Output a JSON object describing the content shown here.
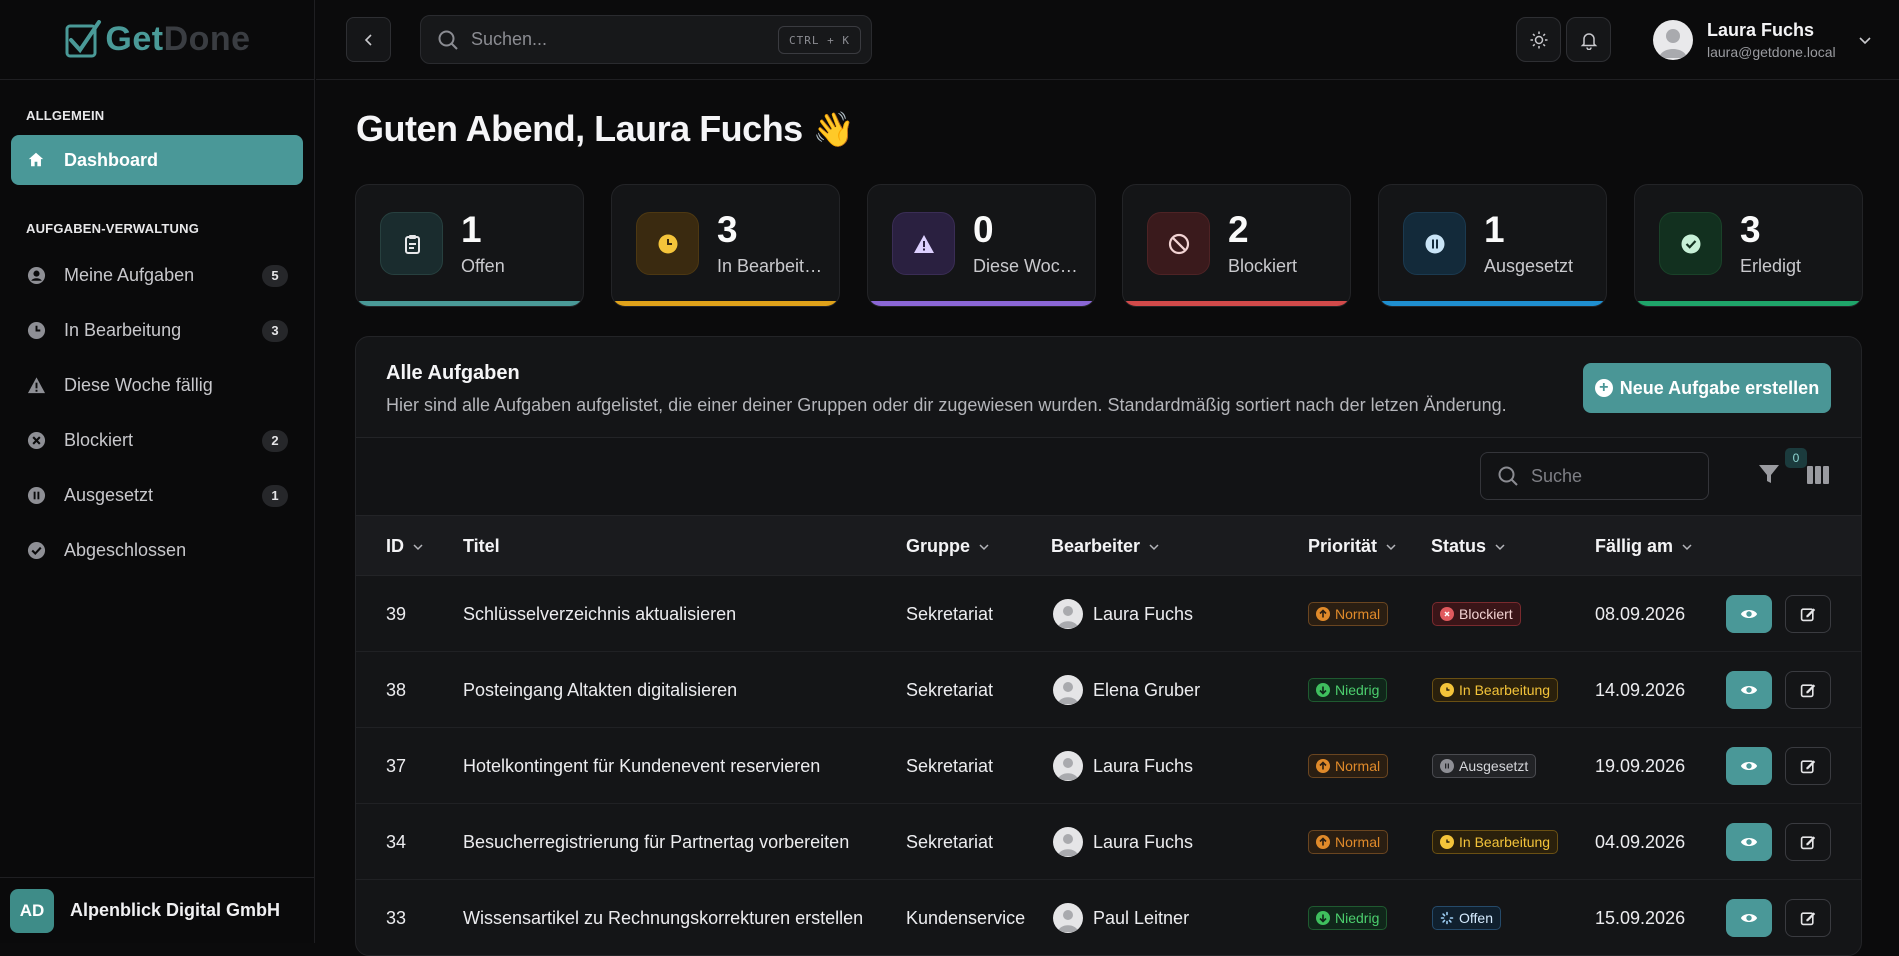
{
  "app": {
    "logo_get": "Get",
    "logo_done": "Done"
  },
  "sidebar": {
    "section_general": "ALLGEMEIN",
    "section_tasks": "AUFGABEN-VERWALTUNG",
    "dashboard": "Dashboard",
    "items": [
      {
        "label": "Meine Aufgaben",
        "badge": "5",
        "icon": "user-circle-icon"
      },
      {
        "label": "In Bearbeitung",
        "badge": "3",
        "icon": "clock-icon"
      },
      {
        "label": "Diese Woche fällig",
        "badge": "",
        "icon": "warning-icon"
      },
      {
        "label": "Blockiert",
        "badge": "2",
        "icon": "x-circle-icon"
      },
      {
        "label": "Ausgesetzt",
        "badge": "1",
        "icon": "pause-circle-icon"
      },
      {
        "label": "Abgeschlossen",
        "badge": "",
        "icon": "check-circle-icon"
      }
    ],
    "org": {
      "initials": "AD",
      "name": "Alpenblick Digital GmbH"
    }
  },
  "topbar": {
    "search_placeholder": "Suchen...",
    "shortcut": "CTRL + K",
    "user_name": "Laura Fuchs",
    "user_email": "laura@getdone.local"
  },
  "greeting": {
    "text": "Guten Abend, Laura Fuchs",
    "emoji": "👋"
  },
  "stats": [
    {
      "value": "1",
      "label": "Offen",
      "color": "#4a9a98"
    },
    {
      "value": "3",
      "label": "In Bearbeitung",
      "color": "#e0a21a"
    },
    {
      "value": "0",
      "label": "Diese Woche fällig",
      "color": "#8b67d6"
    },
    {
      "value": "2",
      "label": "Blockiert",
      "color": "#d24a4a"
    },
    {
      "value": "1",
      "label": "Ausgesetzt",
      "color": "#1f8fd0"
    },
    {
      "value": "3",
      "label": "Erledigt",
      "color": "#1fa56a"
    }
  ],
  "panel": {
    "title": "Alle Aufgaben",
    "subtitle": "Hier sind alle Aufgaben aufgelistet, die einer deiner Gruppen oder dir zugewiesen wurden. Standardmäßig sortiert nach der letzen Änderung.",
    "new_button": "Neue Aufgabe erstellen",
    "search_placeholder": "Suche",
    "filter_count": "0"
  },
  "table": {
    "headers": {
      "id": "ID",
      "title": "Titel",
      "group": "Gruppe",
      "assignee": "Bearbeiter",
      "priority": "Priorität",
      "status": "Status",
      "due": "Fällig am"
    },
    "rows": [
      {
        "id": "39",
        "title": "Schlüsselverzeichnis aktualisieren",
        "group": "Sekretariat",
        "assignee": "Laura Fuchs",
        "priority": "Normal",
        "status": "Blockiert",
        "due": "08.09.2026"
      },
      {
        "id": "38",
        "title": "Posteingang Altakten digitalisieren",
        "group": "Sekretariat",
        "assignee": "Elena Gruber",
        "priority": "Niedrig",
        "status": "In Bearbeitung",
        "due": "14.09.2026"
      },
      {
        "id": "37",
        "title": "Hotelkontingent für Kundenevent reservieren",
        "group": "Sekretariat",
        "assignee": "Laura Fuchs",
        "priority": "Normal",
        "status": "Ausgesetzt",
        "due": "19.09.2026"
      },
      {
        "id": "34",
        "title": "Besucherregistrierung für Partnertag vorbereiten",
        "group": "Sekretariat",
        "assignee": "Laura Fuchs",
        "priority": "Normal",
        "status": "In Bearbeitung",
        "due": "04.09.2026"
      },
      {
        "id": "33",
        "title": "Wissensartikel zu Rechnungskorrekturen erstellen",
        "group": "Kundenservice",
        "assignee": "Paul Leitner",
        "priority": "Niedrig",
        "status": "Offen",
        "due": "15.09.2026"
      }
    ]
  }
}
